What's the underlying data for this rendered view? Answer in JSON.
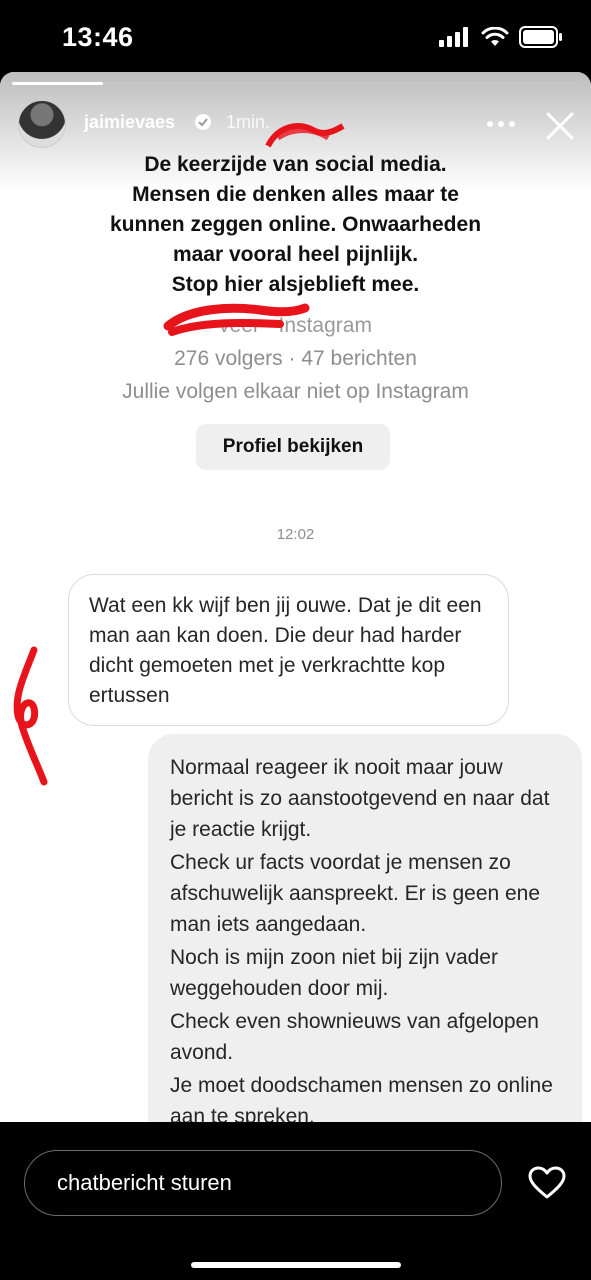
{
  "status_bar": {
    "time": "13:46",
    "icons": [
      "signal-icon",
      "wifi-icon",
      "battery-icon"
    ]
  },
  "story": {
    "progress": 0.16,
    "username": "jaimievaes",
    "verified": true,
    "time_ago": "1min.",
    "headline": [
      "De keerzijde van social media.",
      "Mensen die denken alles maar te",
      "kunnen zeggen online. Onwaarheden",
      "maar vooral heel pijnlijk.",
      "Stop hier alsjeblieft mee."
    ],
    "profile": {
      "subtitle": "veer · Instagram",
      "followers": "276 volgers · 47 berichten",
      "mutual": "Jullie volgen elkaar niet op Instagram",
      "button": "Profiel bekijken"
    },
    "messages": {
      "time": "12:02",
      "incoming": "Wat een kk wijf ben jij ouwe. Dat je dit een man aan kan doen. Die deur had harder dicht gemoeten met je verkrachtte kop ertussen",
      "outgoing": [
        "Normaal reageer ik nooit maar jouw bericht is zo aanstootgevend en naar dat je reactie krijgt.",
        "Check ur facts voordat je mensen zo afschuwelijk aanspreekt. Er is geen ene man iets aangedaan.",
        "Noch is mijn zoon niet bij zijn vader weggehouden door mij.",
        "Check even shownieuws van afgelopen avond.",
        "Je moet doodschamen mensen zo online aan te spreken."
      ]
    }
  },
  "reply": {
    "placeholder": "chatbericht sturen"
  },
  "colors": {
    "background": "#000000",
    "card": "#ffffff",
    "bubble_out": "#efefef",
    "redaction": "#e8141c"
  }
}
